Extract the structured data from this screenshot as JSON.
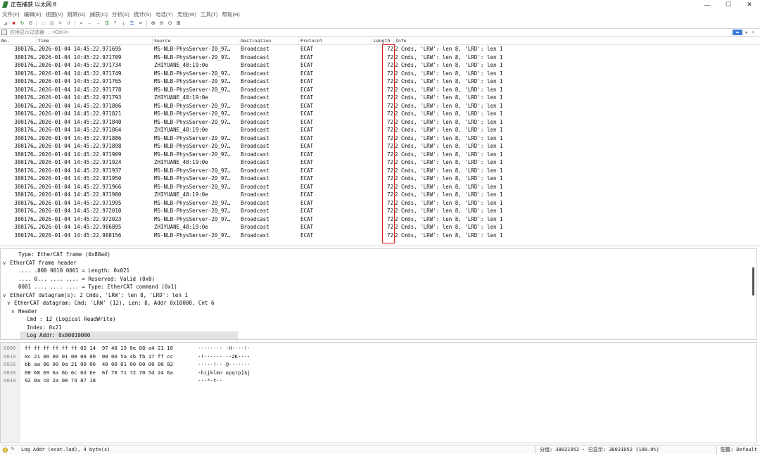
{
  "window": {
    "title": "正在捕获 以太网 8",
    "controls": [
      "—",
      "☐",
      "✕"
    ]
  },
  "menu": [
    "文件(F)",
    "编辑(E)",
    "视图(V)",
    "跳转(G)",
    "捕获(C)",
    "分析(A)",
    "统计(S)",
    "电话(Y)",
    "无线(W)",
    "工具(T)",
    "帮助(H)"
  ],
  "toolbar": {
    "icons": [
      {
        "name": "shark-fin-start-icon",
        "glyph": "◢",
        "color": "#9aa3ad"
      },
      {
        "name": "stop-capture-icon",
        "glyph": "■",
        "color": "#d32020"
      },
      {
        "name": "restart-capture-icon",
        "glyph": "↻",
        "color": "#2f8a3a"
      },
      {
        "name": "capture-options-icon",
        "glyph": "⚙",
        "color": "#777777"
      },
      {
        "name": "open-file-icon",
        "glyph": "▭",
        "color": "#9aa3ad"
      },
      {
        "name": "save-file-icon",
        "glyph": "▥",
        "color": "#9aa3ad"
      },
      {
        "name": "close-file-icon",
        "glyph": "✕",
        "color": "#888888"
      },
      {
        "name": "reload-file-icon",
        "glyph": "↺",
        "color": "#888888"
      },
      {
        "name": "find-packet-icon",
        "glyph": "⌕",
        "color": "#333333"
      },
      {
        "name": "go-back-icon",
        "glyph": "←",
        "color": "#2f8a3a"
      },
      {
        "name": "go-forward-icon",
        "glyph": "→",
        "color": "#2f8a3a"
      },
      {
        "name": "go-to-packet-icon",
        "glyph": "⇶",
        "color": "#2f8a3a"
      },
      {
        "name": "go-first-icon",
        "glyph": "⤒",
        "color": "#2f8a3a"
      },
      {
        "name": "go-last-icon",
        "glyph": "⤓",
        "color": "#2f8a3a"
      },
      {
        "name": "autoscroll-icon",
        "glyph": "☰",
        "color": "#2a5db0"
      },
      {
        "name": "colorize-icon",
        "glyph": "≡",
        "color": "#555555"
      },
      {
        "name": "zoom-in-icon",
        "glyph": "⊕",
        "color": "#333333"
      },
      {
        "name": "zoom-out-icon",
        "glyph": "⊖",
        "color": "#333333"
      },
      {
        "name": "zoom-normal-icon",
        "glyph": "⊙",
        "color": "#333333"
      },
      {
        "name": "resize-columns-icon",
        "glyph": "⊞",
        "color": "#333333"
      }
    ]
  },
  "filter": {
    "placeholder": "应用显示过滤器 … <Ctrl-/>",
    "apply_label": "➡",
    "dropdown": "▾",
    "add": "+"
  },
  "columns": {
    "no": "No.",
    "time": "Time",
    "source": "Source",
    "destination": "Destination",
    "protocol": "Protocol",
    "length": "Length",
    "info": "Info"
  },
  "packets": [
    {
      "no": "380176…",
      "time": "2026-01-04 14:45:22.971695",
      "source": "MS-NLB-PhysServer-20_97…",
      "destination": "Broadcast",
      "protocol": "ECAT",
      "length": "72",
      "info": "2 Cmds, 'LRW': len 8, 'LRD': len 1"
    },
    {
      "no": "380176…",
      "time": "2026-01-04 14:45:22.971709",
      "source": "MS-NLB-PhysServer-20_97…",
      "destination": "Broadcast",
      "protocol": "ECAT",
      "length": "72",
      "info": "2 Cmds, 'LRW': len 8, 'LRD': len 1"
    },
    {
      "no": "380176…",
      "time": "2026-01-04 14:45:22.971734",
      "source": "ZHIYUANE_48:19:0e",
      "destination": "Broadcast",
      "protocol": "ECAT",
      "length": "72",
      "info": "2 Cmds, 'LRW': len 8, 'LRD': len 1"
    },
    {
      "no": "380176…",
      "time": "2026-01-04 14:45:22.971749",
      "source": "MS-NLB-PhysServer-20_97…",
      "destination": "Broadcast",
      "protocol": "ECAT",
      "length": "72",
      "info": "2 Cmds, 'LRW': len 8, 'LRD': len 1"
    },
    {
      "no": "380176…",
      "time": "2026-01-04 14:45:22.971765",
      "source": "MS-NLB-PhysServer-20_97…",
      "destination": "Broadcast",
      "protocol": "ECAT",
      "length": "72",
      "info": "2 Cmds, 'LRW': len 8, 'LRD': len 1"
    },
    {
      "no": "380176…",
      "time": "2026-01-04 14:45:22.971778",
      "source": "MS-NLB-PhysServer-20_97…",
      "destination": "Broadcast",
      "protocol": "ECAT",
      "length": "72",
      "info": "2 Cmds, 'LRW': len 8, 'LRD': len 1"
    },
    {
      "no": "380176…",
      "time": "2026-01-04 14:45:22.971793",
      "source": "ZHIYUANE_48:19:0e",
      "destination": "Broadcast",
      "protocol": "ECAT",
      "length": "72",
      "info": "2 Cmds, 'LRW': len 8, 'LRD': len 1"
    },
    {
      "no": "380176…",
      "time": "2026-01-04 14:45:22.971806",
      "source": "MS-NLB-PhysServer-20_97…",
      "destination": "Broadcast",
      "protocol": "ECAT",
      "length": "72",
      "info": "2 Cmds, 'LRW': len 8, 'LRD': len 1"
    },
    {
      "no": "380176…",
      "time": "2026-01-04 14:45:22.971821",
      "source": "MS-NLB-PhysServer-20_97…",
      "destination": "Broadcast",
      "protocol": "ECAT",
      "length": "72",
      "info": "2 Cmds, 'LRW': len 8, 'LRD': len 1"
    },
    {
      "no": "380176…",
      "time": "2026-01-04 14:45:22.971840",
      "source": "MS-NLB-PhysServer-20_97…",
      "destination": "Broadcast",
      "protocol": "ECAT",
      "length": "72",
      "info": "2 Cmds, 'LRW': len 8, 'LRD': len 1"
    },
    {
      "no": "380176…",
      "time": "2026-01-04 14:45:22.971864",
      "source": "ZHIYUANE_48:19:0e",
      "destination": "Broadcast",
      "protocol": "ECAT",
      "length": "72",
      "info": "2 Cmds, 'LRW': len 8, 'LRD': len 1"
    },
    {
      "no": "380176…",
      "time": "2026-01-04 14:45:22.971886",
      "source": "MS-NLB-PhysServer-20_97…",
      "destination": "Broadcast",
      "protocol": "ECAT",
      "length": "72",
      "info": "2 Cmds, 'LRW': len 8, 'LRD': len 1"
    },
    {
      "no": "380176…",
      "time": "2026-01-04 14:45:22.971898",
      "source": "MS-NLB-PhysServer-20_97…",
      "destination": "Broadcast",
      "protocol": "ECAT",
      "length": "72",
      "info": "2 Cmds, 'LRW': len 8, 'LRD': len 1"
    },
    {
      "no": "380176…",
      "time": "2026-01-04 14:45:22.971909",
      "source": "MS-NLB-PhysServer-20_97…",
      "destination": "Broadcast",
      "protocol": "ECAT",
      "length": "72",
      "info": "2 Cmds, 'LRW': len 8, 'LRD': len 1"
    },
    {
      "no": "380176…",
      "time": "2026-01-04 14:45:22.971924",
      "source": "ZHIYUANE_48:19:0e",
      "destination": "Broadcast",
      "protocol": "ECAT",
      "length": "72",
      "info": "2 Cmds, 'LRW': len 8, 'LRD': len 1"
    },
    {
      "no": "380176…",
      "time": "2026-01-04 14:45:22.971937",
      "source": "MS-NLB-PhysServer-20_97…",
      "destination": "Broadcast",
      "protocol": "ECAT",
      "length": "72",
      "info": "2 Cmds, 'LRW': len 8, 'LRD': len 1"
    },
    {
      "no": "380176…",
      "time": "2026-01-04 14:45:22.971950",
      "source": "MS-NLB-PhysServer-20_97…",
      "destination": "Broadcast",
      "protocol": "ECAT",
      "length": "72",
      "info": "2 Cmds, 'LRW': len 8, 'LRD': len 1"
    },
    {
      "no": "380176…",
      "time": "2026-01-04 14:45:22.971966",
      "source": "MS-NLB-PhysServer-20_97…",
      "destination": "Broadcast",
      "protocol": "ECAT",
      "length": "72",
      "info": "2 Cmds, 'LRW': len 8, 'LRD': len 1"
    },
    {
      "no": "380176…",
      "time": "2026-01-04 14:45:22.971980",
      "source": "ZHIYUANE_48:19:0e",
      "destination": "Broadcast",
      "protocol": "ECAT",
      "length": "72",
      "info": "2 Cmds, 'LRW': len 8, 'LRD': len 1"
    },
    {
      "no": "380176…",
      "time": "2026-01-04 14:45:22.971995",
      "source": "MS-NLB-PhysServer-20_97…",
      "destination": "Broadcast",
      "protocol": "ECAT",
      "length": "72",
      "info": "2 Cmds, 'LRW': len 8, 'LRD': len 1"
    },
    {
      "no": "380176…",
      "time": "2026-01-04 14:45:22.972010",
      "source": "MS-NLB-PhysServer-20_97…",
      "destination": "Broadcast",
      "protocol": "ECAT",
      "length": "72",
      "info": "2 Cmds, 'LRW': len 8, 'LRD': len 1"
    },
    {
      "no": "380176…",
      "time": "2026-01-04 14:45:22.972023",
      "source": "MS-NLB-PhysServer-20_97…",
      "destination": "Broadcast",
      "protocol": "ECAT",
      "length": "72",
      "info": "2 Cmds, 'LRW': len 8, 'LRD': len 1"
    },
    {
      "no": "380176…",
      "time": "2026-01-04 14:45:22.986895",
      "source": "ZHIYUANE_48:19:0e",
      "destination": "Broadcast",
      "protocol": "ECAT",
      "length": "72",
      "info": "2 Cmds, 'LRW': len 8, 'LRD': len 1"
    },
    {
      "no": "380176…",
      "time": "2026-01-04 14:45:22.988156",
      "source": "MS-NLB-PhysServer-20_97…",
      "destination": "Broadcast",
      "protocol": "ECAT",
      "length": "72",
      "info": "2 Cmds, 'LRW': len 8, 'LRD': len 1"
    }
  ],
  "details": [
    {
      "indent": 2,
      "chevron": "",
      "text": "Type: EtherCAT frame (0x88a4)"
    },
    {
      "indent": 0,
      "chevron": "∨",
      "text": "EtherCAT frame header"
    },
    {
      "indent": 2,
      "chevron": "",
      "text": ".... .000 0010 0001 = Length: 0x021"
    },
    {
      "indent": 2,
      "chevron": "",
      "text": ".... 0... .... .... = Reserved: Valid (0x0)"
    },
    {
      "indent": 2,
      "chevron": "",
      "text": "0001 .... .... .... = Type: EtherCAT command (0x1)"
    },
    {
      "indent": 0,
      "chevron": "∨",
      "text": "EtherCAT datagram(s): 2 Cmds, 'LRW': len 8, 'LRD': len 1"
    },
    {
      "indent": 1,
      "chevron": "∨",
      "text": "EtherCAT datagram: Cmd: 'LRW' (12), Len: 8, Addr 0x10000, Cnt 6"
    },
    {
      "indent": 2,
      "chevron": "∨",
      "text": "Header"
    },
    {
      "indent": 4,
      "chevron": "",
      "text": "Cmd        : 12 (Logical ReadWrite)"
    },
    {
      "indent": 4,
      "chevron": "",
      "text": "Index: 0x21"
    },
    {
      "indent": 4,
      "chevron": "",
      "text": "Log Addr: 0x00010000",
      "selected": true
    }
  ],
  "bytes": [
    {
      "offset": "0000",
      "hex": "ff ff ff ff ff ff 02 14  97 48 19 0e 88 a4 21 10",
      "ascii": "········ ·H····!·"
    },
    {
      "offset": "0010",
      "hex": "0c 21 00 00 01 00 08 00  00 00 5a 4b fb 17 ff cc",
      "ascii": "·!······ ··ZK····"
    },
    {
      "offset": "0020",
      "hex": "bb aa 06 00 0a 21 00 00  40 00 01 00 00 00 00 02",
      "ascii": "·····!·· @·······"
    },
    {
      "offset": "0030",
      "hex": "00 68 69 6a 6b 6c 6d 6e  6f 70 71 72 70 5d 24 6a",
      "ascii": "·hijklmn opqrp]$j"
    },
    {
      "offset": "0040",
      "hex": "92 0a c0 2a 08 74 87 18",
      "ascii": "···*·t··"
    }
  ],
  "status": {
    "field_info": "Log Addr (ecat.lad), 4 byte(s)",
    "packets": "分组: 38021052 · 已显示: 38021052 (100.0%)",
    "profile": "配置: Default"
  },
  "colors": {
    "highlight": "#e02020",
    "selected_row": "#e3e3e3",
    "filter_apply": "#3b7dd8"
  }
}
